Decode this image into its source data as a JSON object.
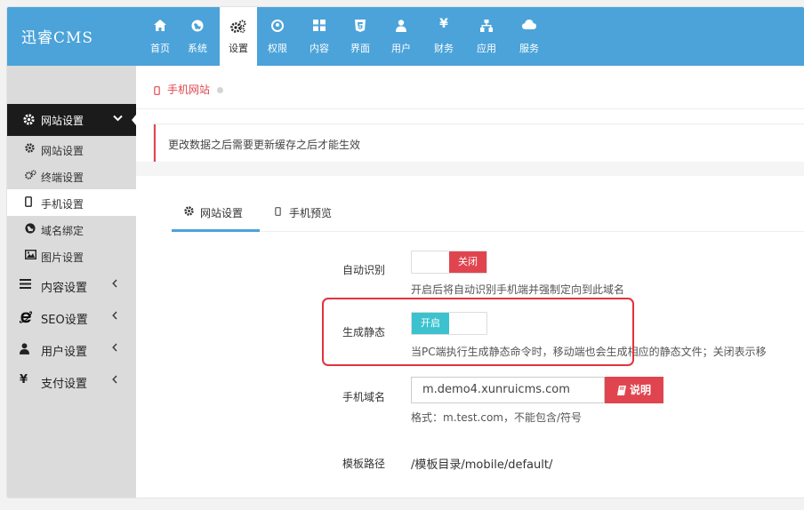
{
  "app": {
    "logo": "迅睿CMS"
  },
  "topnav": {
    "items": [
      {
        "label": "首页",
        "icon": "home-icon"
      },
      {
        "label": "系统",
        "icon": "globe-icon"
      },
      {
        "label": "设置",
        "icon": "cogs-icon"
      },
      {
        "label": "权限",
        "icon": "user-circle-icon"
      },
      {
        "label": "内容",
        "icon": "grid-icon"
      },
      {
        "label": "界面",
        "icon": "html5-icon"
      },
      {
        "label": "用户",
        "icon": "user-icon"
      },
      {
        "label": "财务",
        "icon": "yen-icon"
      },
      {
        "label": "应用",
        "icon": "sitemap-icon"
      },
      {
        "label": "服务",
        "icon": "cloud-icon"
      }
    ],
    "active_index": 2
  },
  "sidebar": {
    "header": "网站设置",
    "sub_items": [
      {
        "label": "网站设置",
        "icon": "gear-icon"
      },
      {
        "label": "终端设置",
        "icon": "cogs-icon"
      },
      {
        "label": "手机设置",
        "icon": "mobile-icon"
      },
      {
        "label": "域名绑定",
        "icon": "globe-icon"
      },
      {
        "label": "图片设置",
        "icon": "image-icon"
      }
    ],
    "active_sub": 2,
    "groups": [
      {
        "label": "内容设置",
        "icon": "list-icon"
      },
      {
        "label": "SEO设置",
        "icon": "ie-icon"
      },
      {
        "label": "用户设置",
        "icon": "user-icon"
      },
      {
        "label": "支付设置",
        "icon": "yen-icon"
      }
    ]
  },
  "breadcrumb": {
    "current": "手机网站"
  },
  "alert": {
    "text": "更改数据之后需要更新缓存之后才能生效"
  },
  "tabs": [
    {
      "label": "网站设置",
      "icon": "gear-icon"
    },
    {
      "label": "手机预览",
      "icon": "mobile-icon"
    }
  ],
  "form": {
    "auto_detect": {
      "label": "自动识别",
      "state": "关闭",
      "help": "开启后将自动识别手机端并强制定向到此域名"
    },
    "static_gen": {
      "label": "生成静态",
      "state": "开启",
      "help": "当PC端执行生成静态命令时，移动端也会生成相应的静态文件；关闭表示移"
    },
    "mobile_domain": {
      "label": "手机域名",
      "value": "m.demo4.xunruicms.com",
      "button": "说明",
      "help": "格式：m.test.com，不能包含/符号"
    },
    "template_path": {
      "label": "模板路径",
      "value": "/模板目录/mobile/default/"
    }
  },
  "colors": {
    "accent": "#4ba3d9",
    "danger": "#e0454f",
    "switch_on": "#3bc2ce",
    "highlight": "#e4323d"
  }
}
